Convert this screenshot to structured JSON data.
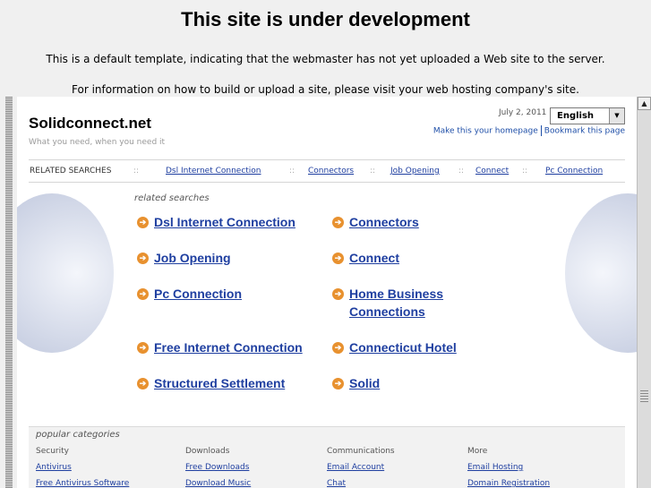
{
  "banner": {
    "title": "This site is under development",
    "line1": "This is a default template, indicating that the webmaster has not yet uploaded a Web site to the server.",
    "line2": "For information on how to build or upload a site, please visit your web hosting company's site."
  },
  "site": {
    "title": "Solidconnect.net",
    "tagline": "What you need, when you need it",
    "date": "July 2, 2011",
    "language": "English",
    "make_homepage": "Make this your homepage",
    "bookmark": "Bookmark this page"
  },
  "related_bar": {
    "label": "RELATED SEARCHES",
    "separator": "::",
    "links": [
      "Dsl Internet Connection",
      "Connectors",
      "Job Opening",
      "Connect",
      "Pc Connection"
    ]
  },
  "related": {
    "label": "related searches",
    "items": [
      "Dsl Internet Connection",
      "Connectors",
      "Job Opening",
      "Connect",
      "Pc Connection",
      "Home Business Connections",
      "Free Internet Connection",
      "Connecticut Hotel",
      "Structured Settlement",
      "Solid"
    ]
  },
  "popular": {
    "label": "popular categories",
    "columns": [
      {
        "heading": "Security",
        "links": [
          "Antivirus",
          "Free Antivirus Software"
        ]
      },
      {
        "heading": "Downloads",
        "links": [
          "Free Downloads",
          "Download Music"
        ]
      },
      {
        "heading": "Communications",
        "links": [
          "Email Account",
          "Chat"
        ]
      },
      {
        "heading": "More",
        "links": [
          "Email Hosting",
          "Domain Registration"
        ]
      }
    ]
  },
  "icons": {
    "arrow": "arrow-right-circle-icon",
    "arrow_color": "#e8912f",
    "link_color": "#1f3fa0"
  }
}
